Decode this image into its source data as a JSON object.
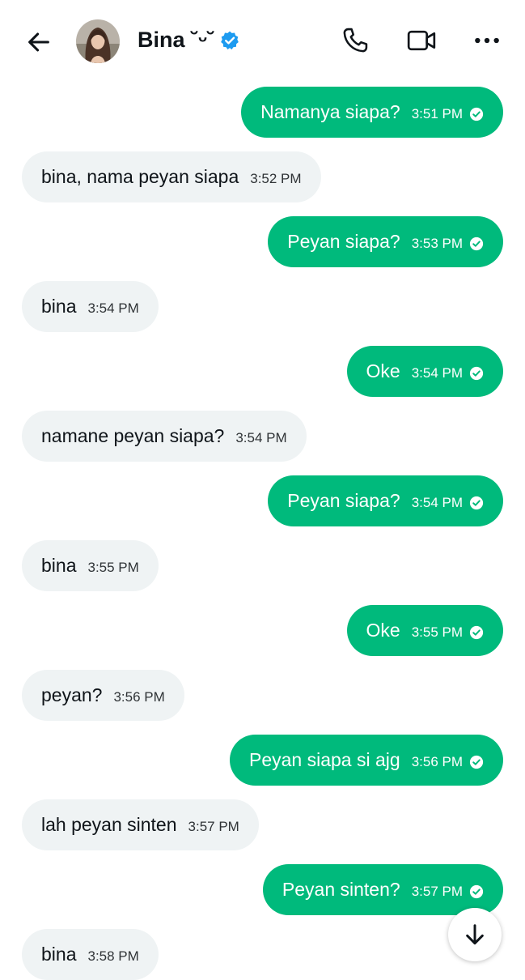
{
  "header": {
    "contact_name": "Bina ˘ᵕ˘",
    "icons": {
      "back": "arrow-left-icon",
      "verified": "verified-badge-icon",
      "call": "phone-icon",
      "video": "video-camera-icon",
      "more": "more-horizontal-icon"
    }
  },
  "colors": {
    "sent_bubble": "#00ba7c",
    "received_bubble": "#eff3f4",
    "verified": "#1d9bf0",
    "text_primary": "#0f1419"
  },
  "messages": [
    {
      "direction": "sent",
      "text": "Namanya siapa?",
      "time": "3:51 PM"
    },
    {
      "direction": "received",
      "text": "bina, nama peyan siapa",
      "time": "3:52 PM"
    },
    {
      "direction": "sent",
      "text": "Peyan siapa?",
      "time": "3:53 PM"
    },
    {
      "direction": "received",
      "text": "bina",
      "time": "3:54 PM"
    },
    {
      "direction": "sent",
      "text": "Oke",
      "time": "3:54 PM"
    },
    {
      "direction": "received",
      "text": "namane peyan siapa?",
      "time": "3:54 PM"
    },
    {
      "direction": "sent",
      "text": "Peyan siapa?",
      "time": "3:54 PM"
    },
    {
      "direction": "received",
      "text": "bina",
      "time": "3:55 PM"
    },
    {
      "direction": "sent",
      "text": "Oke",
      "time": "3:55 PM"
    },
    {
      "direction": "received",
      "text": "peyan?",
      "time": "3:56 PM"
    },
    {
      "direction": "sent",
      "text": "Peyan siapa si ajg",
      "time": "3:56 PM"
    },
    {
      "direction": "received",
      "text": "lah peyan sinten",
      "time": "3:57 PM"
    },
    {
      "direction": "sent",
      "text": "Peyan sinten?",
      "time": "3:57 PM"
    },
    {
      "direction": "received",
      "text": "bina",
      "time": "3:58 PM"
    }
  ],
  "scroll_down": {
    "icon": "arrow-down-icon"
  }
}
